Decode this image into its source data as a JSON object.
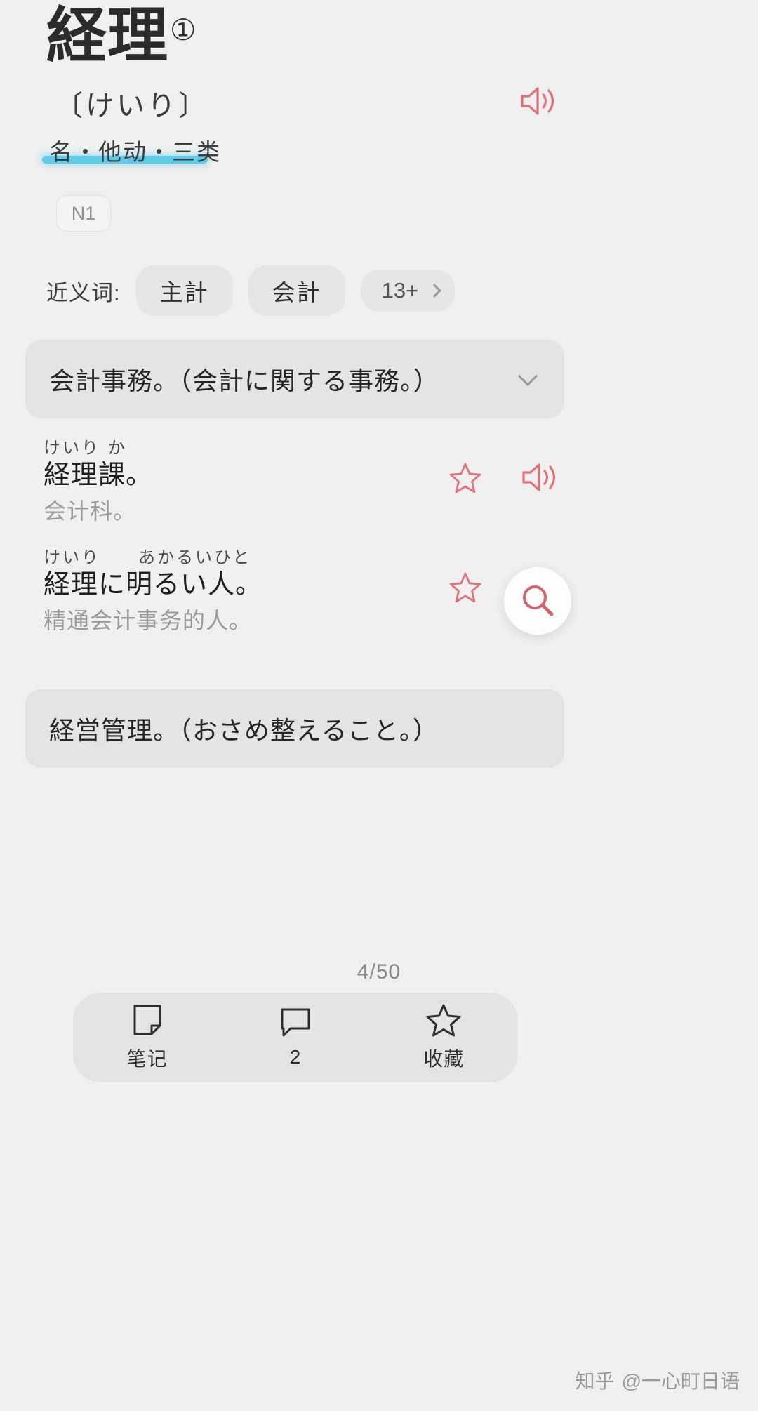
{
  "entry": {
    "headword": "経理",
    "sense_marker": "①",
    "reading": "〔けいり〕",
    "part_of_speech": "名・他动・三类",
    "jlpt_level": "N1"
  },
  "synonyms": {
    "label": "近义词:",
    "items": [
      "主計",
      "会計"
    ],
    "more_label": "13+",
    "more_icon": "chevron-right-icon"
  },
  "definitions": [
    {
      "text": "会計事務。（会計に関する事務。）",
      "toggle_icon": "chevron-down-icon",
      "examples": [
        {
          "furigana": "けいり か",
          "japanese": "経理課。",
          "chinese": "会计科。",
          "favorite_icon": "star-icon",
          "audio_icon": "speaker-icon"
        },
        {
          "furigana": "けいり　　あかるいひと",
          "japanese": "経理に明るい人。",
          "chinese": "精通会计事务的人。",
          "favorite_icon": "star-icon",
          "audio_icon": "speaker-icon"
        }
      ]
    },
    {
      "text": "経営管理。（おさめ整えること。）",
      "toggle_icon": "",
      "examples": []
    }
  ],
  "header_audio": {
    "icon": "speaker-icon"
  },
  "floating_button": {
    "icon": "search-icon"
  },
  "page_counter": "4/50",
  "bottom_bar": {
    "items": [
      {
        "icon": "note-icon",
        "label": "笔记"
      },
      {
        "icon": "comment-icon",
        "label": "2"
      },
      {
        "icon": "star-icon",
        "label": "收藏"
      }
    ]
  },
  "watermark": {
    "site": "知乎",
    "account": "@一心町日语"
  },
  "colors": {
    "background": "#f0f0f0",
    "card": "#e4e4e4",
    "accent_highlight": "#5ecbe8",
    "accent_red": "#e0707a",
    "text_primary": "#1f1f1f",
    "text_muted": "#9b9b9b"
  }
}
